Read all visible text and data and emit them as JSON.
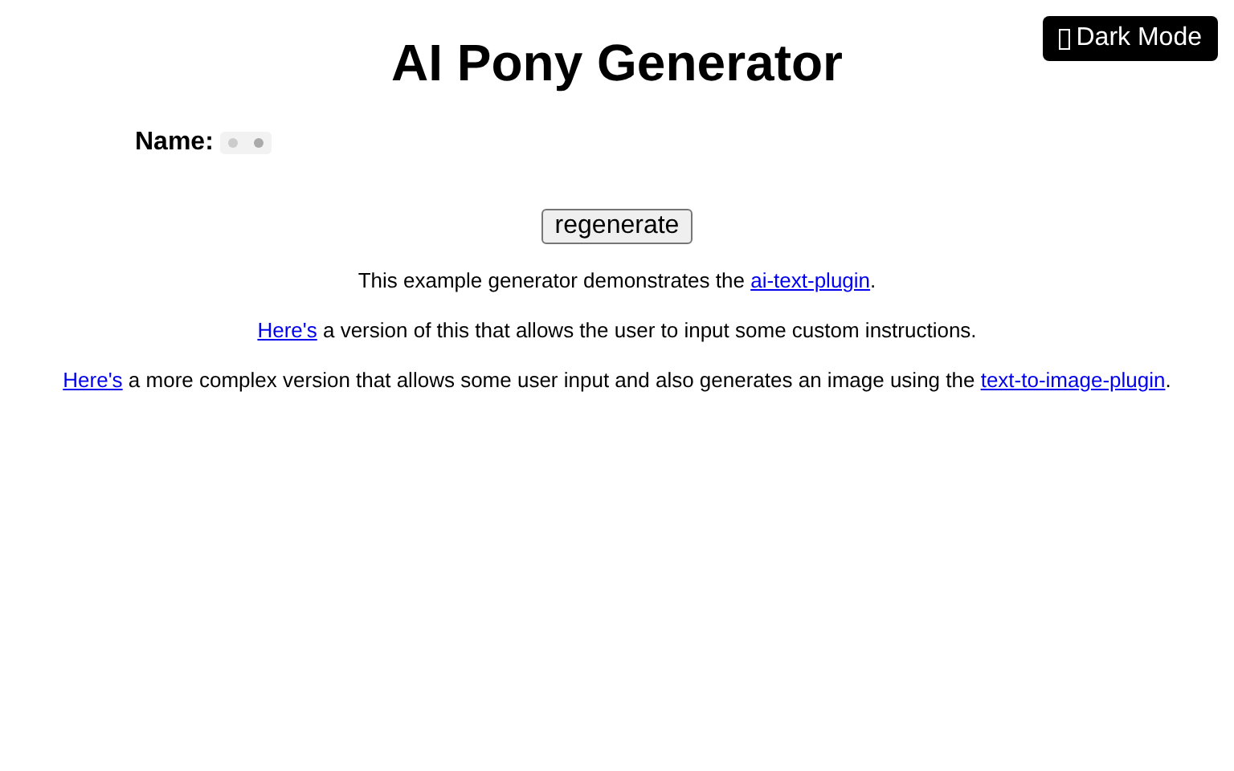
{
  "title": "AI Pony Generator",
  "dark_mode_button": {
    "label": "Dark Mode"
  },
  "name_field": {
    "label": "Name:"
  },
  "regenerate_button": {
    "label": "regenerate"
  },
  "paragraphs": [
    {
      "before": "This example generator demonstrates the ",
      "link": "ai-text-plugin",
      "after": "."
    },
    {
      "link": "Here's",
      "after": " a version of this that allows the user to input some custom instructions."
    },
    {
      "link": "Here's",
      "after": " a more complex version that allows some user input and also generates an image using the ",
      "link2": "text-to-image-plugin",
      "after2": "."
    }
  ]
}
